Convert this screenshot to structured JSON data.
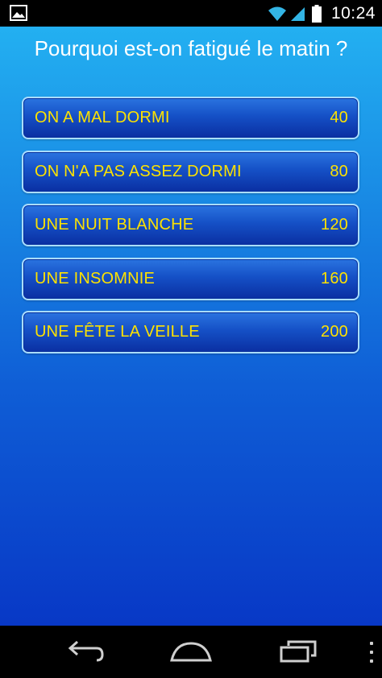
{
  "status_bar": {
    "time": "10:24",
    "icons": [
      "gallery-icon",
      "wifi-icon",
      "signal-icon",
      "battery-icon"
    ]
  },
  "question": {
    "text": "Pourquoi est-on fatigué le matin ?"
  },
  "answers": [
    {
      "label": "ON A MAL DORMI",
      "points": "40"
    },
    {
      "label": "ON N'A PAS ASSEZ DORMI",
      "points": "80"
    },
    {
      "label": "UNE NUIT BLANCHE",
      "points": "120"
    },
    {
      "label": "UNE INSOMNIE",
      "points": "160"
    },
    {
      "label": "UNE FÊTE LA VEILLE",
      "points": "200"
    }
  ],
  "nav_bar": {
    "icons": [
      "back-icon",
      "home-icon",
      "recent-apps-icon",
      "menu-icon"
    ]
  },
  "colors": {
    "answer_text": "#fde200",
    "background_top": "#23b0f1",
    "background_bottom": "#0838c6",
    "answer_border": "#a9ddff"
  }
}
